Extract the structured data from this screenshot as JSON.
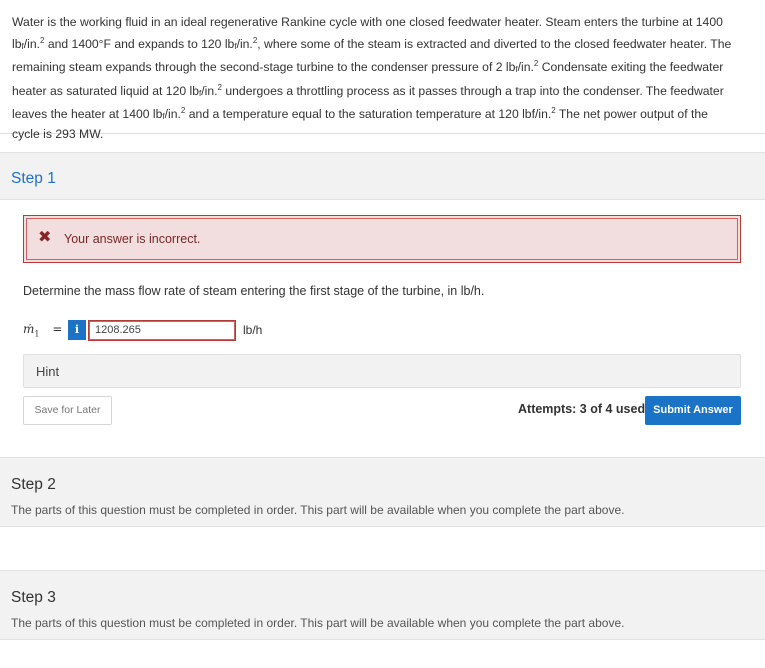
{
  "problem": {
    "lines": [
      "Water is the working fluid in an ideal regenerative Rankine cycle with one closed feedwater heater. Steam enters the turbine at 1400",
      "lb<sub>f</sub>/in.<sup>2</sup> and 1400°F and expands to 120 lb<sub>f</sub>/in.<sup>2</sup>, where some of the steam is extracted and diverted to the closed feedwater heater. The",
      "remaining steam expands through the second-stage turbine to the condenser pressure of 2 lb<sub>f</sub>/in.<sup>2</sup> Condensate exiting the feedwater",
      "heater as saturated liquid at 120 lb<sub>f</sub>/in.<sup>2</sup> undergoes a throttling process as it passes through a trap into the condenser. The feedwater",
      "leaves the heater at 1400 lb<sub>f</sub>/in.<sup>2</sup> and a temperature equal to the saturation temperature at 120 lbf/in.<sup>2</sup> The net power output of the",
      "cycle is 293 MW."
    ]
  },
  "step1": {
    "title": "Step 1",
    "alert_icon": "close-icon",
    "alert_text": "Your answer is incorrect.",
    "question": "Determine the mass flow rate of steam entering the first stage of the turbine, in lb/h.",
    "eq_symbol": "ṁ",
    "eq_subscript": "1",
    "eq_equals": "=",
    "info_label": "i",
    "answer_value": "1208.265",
    "unit": "lb/h",
    "hint_label": "Hint",
    "save_label": "Save for Later",
    "attempts_text": "Attempts: 3 of 4 used",
    "submit_label": "Submit Answer"
  },
  "step2": {
    "title": "Step 2",
    "description": "The parts of this question must be completed in order. This part will be available when you complete the part above."
  },
  "step3": {
    "title": "Step 3",
    "description": "The parts of this question must be completed in order. This part will be available when you complete the part above."
  },
  "colors": {
    "accent": "#1a73c6",
    "error_bg": "#f2dede",
    "error_border": "#b73a3a",
    "panel_bg": "#f2f2f2"
  }
}
